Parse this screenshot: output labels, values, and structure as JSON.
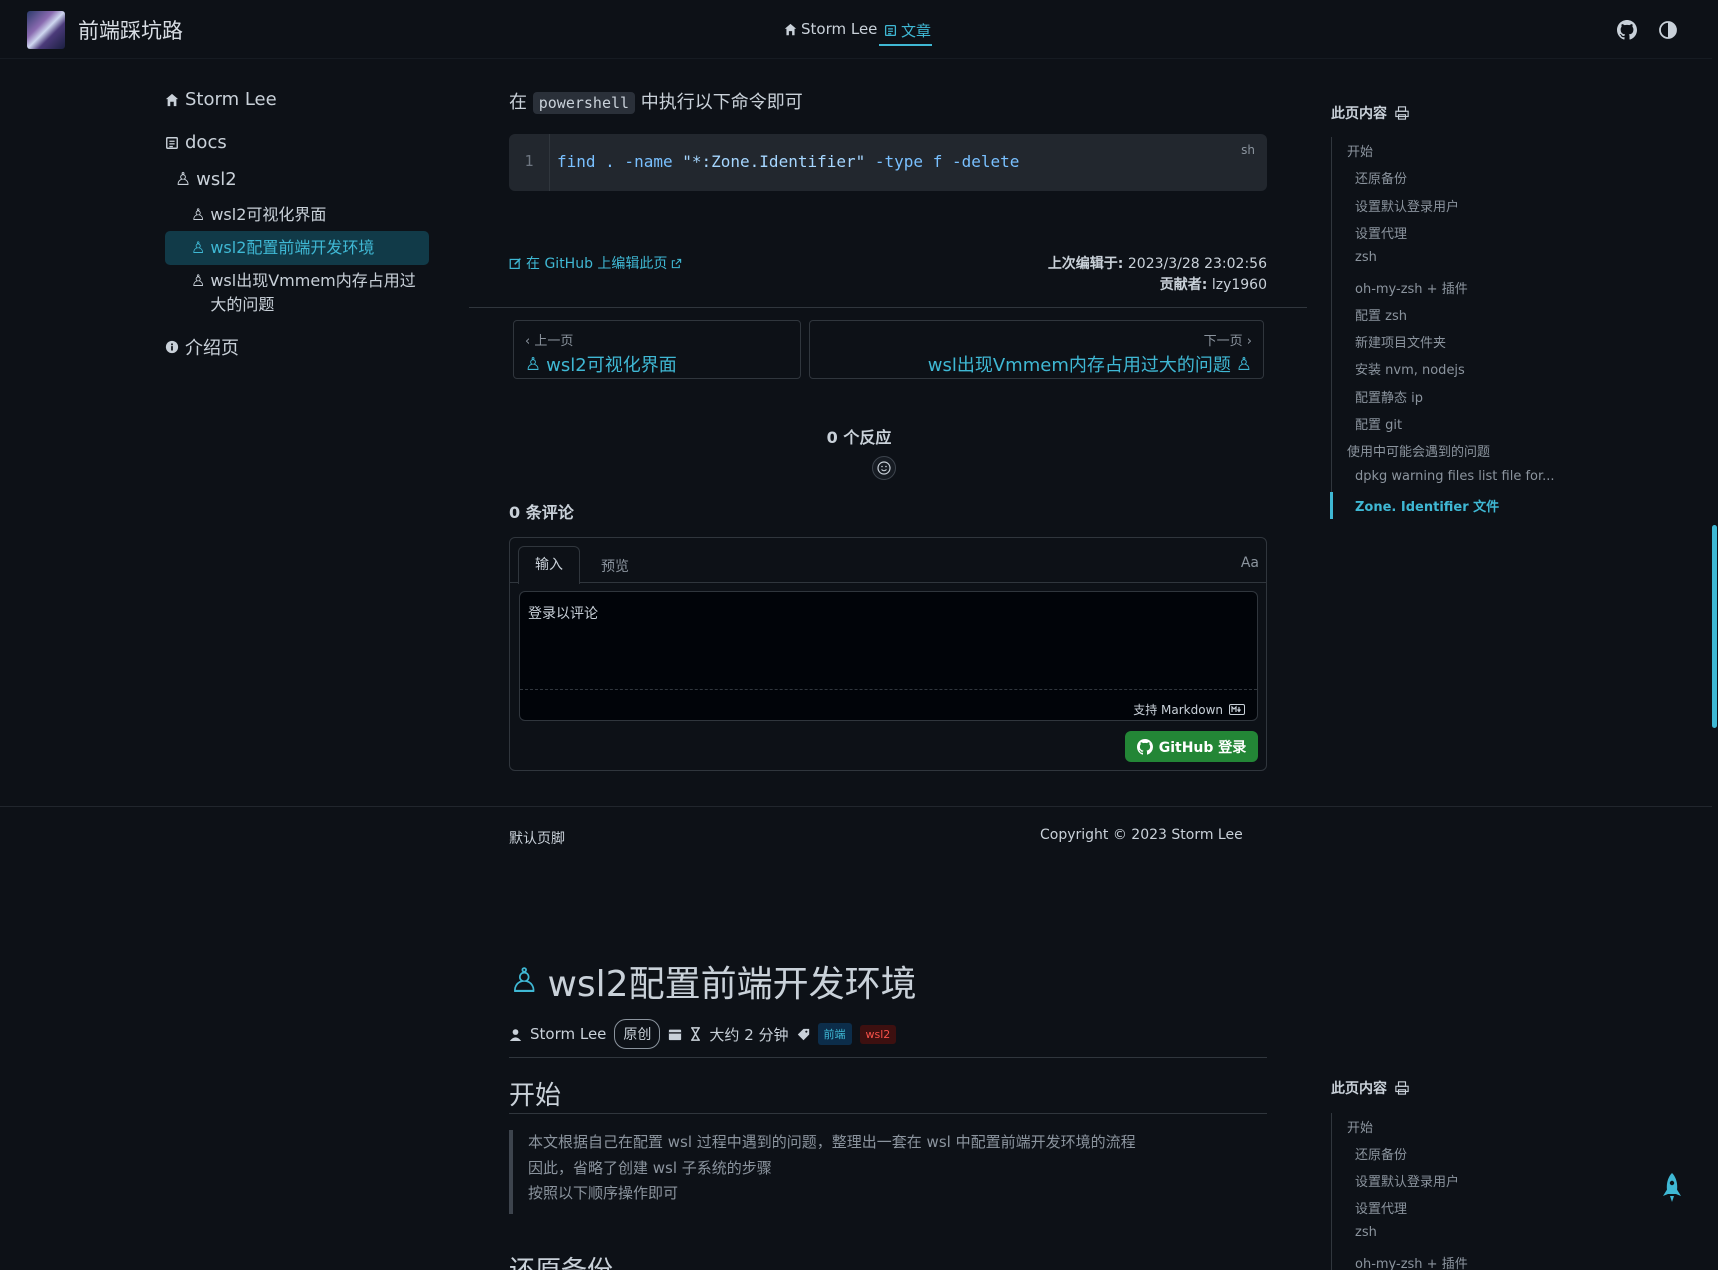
{
  "navbar": {
    "site_name": "前端踩坑路",
    "links": [
      {
        "label": "Storm Lee",
        "icon": "home-icon"
      },
      {
        "label": "文章",
        "icon": "article-icon",
        "active": true
      }
    ],
    "right_icons": [
      "github-icon",
      "theme-toggle-icon"
    ]
  },
  "sidebar": {
    "home": "Storm Lee",
    "docs": "docs",
    "wsl2": "wsl2",
    "items": [
      {
        "label": "wsl2可视化界面"
      },
      {
        "label": "wsl2配置前端开发环境",
        "active": true
      },
      {
        "label": "wsl出现Vmmem内存占用过大的问题"
      }
    ],
    "intro": "介绍页"
  },
  "article_top": {
    "paragraph_pre": "在",
    "inline_code": "powershell",
    "paragraph_post": "中执行以下命令即可",
    "code": {
      "line_number": "1",
      "cmd": "find . -name ",
      "str": "\"*:Zone.Identifier\"",
      "rest": " -type f -delete",
      "lang": "sh"
    },
    "edit_link": "在 GitHub 上编辑此页",
    "last_edited_label": "上次编辑于:",
    "last_edited_value": "2023/3/28 23:02:56",
    "contributors_label": "贡献者:",
    "contributors_value": "lzy1960"
  },
  "pager": {
    "prev_hint": "‹ 上一页",
    "prev_title": "wsl2可视化界面",
    "next_hint": "下一页 ›",
    "next_title": "wsl出现Vmmem内存占用过大的问题"
  },
  "comments": {
    "reactions": "0 个反应",
    "count": "0 条评论",
    "tab_input": "输入",
    "tab_preview": "预览",
    "font_toggle": "Aa",
    "placeholder": "登录以评论",
    "markdown_note": "支持 Markdown",
    "login_button": "GitHub 登录"
  },
  "footer": {
    "left": "默认页脚",
    "right": "Copyright © 2023 Storm Lee"
  },
  "article": {
    "title": "wsl2配置前端开发环境",
    "author": "Storm Lee",
    "original_badge": "原创",
    "read_time": "大约 2 分钟",
    "tags": [
      "前端",
      "wsl2"
    ],
    "h2_start": "开始",
    "quote_lines": [
      "本文根据自己在配置 wsl 过程中遇到的问题，整理出一套在 wsl 中配置前端开发环境的流程",
      "因此，省略了创建 wsl 子系统的步骤",
      "按照以下顺序操作即可"
    ],
    "h2_next": "还原备份"
  },
  "toc": {
    "title": "此页内容",
    "items": [
      {
        "label": "开始",
        "level": 1
      },
      {
        "label": "还原备份",
        "level": 2
      },
      {
        "label": "设置默认登录用户",
        "level": 2
      },
      {
        "label": "设置代理",
        "level": 2
      },
      {
        "label": "zsh",
        "level": 2
      },
      {
        "label": "oh-my-zsh + 插件",
        "level": 2
      },
      {
        "label": "配置 zsh",
        "level": 2
      },
      {
        "label": "新建项目文件夹",
        "level": 2
      },
      {
        "label": "安装 nvm, nodejs",
        "level": 2
      },
      {
        "label": "配置静态 ip",
        "level": 2
      },
      {
        "label": "配置 git",
        "level": 2
      },
      {
        "label": "使用中可能会遇到的问题",
        "level": 1
      },
      {
        "label": "dpkg warning files list file for...",
        "level": 2
      },
      {
        "label": "Zone. Identifier 文件",
        "level": 2,
        "active": true
      }
    ],
    "items_bottom": [
      {
        "label": "开始",
        "level": 1
      },
      {
        "label": "还原备份",
        "level": 2
      },
      {
        "label": "设置默认登录用户",
        "level": 2
      },
      {
        "label": "设置代理",
        "level": 2
      },
      {
        "label": "zsh",
        "level": 2
      },
      {
        "label": "oh-my-zsh + 插件",
        "level": 2
      }
    ]
  },
  "colors": {
    "background": "#0d1117",
    "accent": "#3fb8d4",
    "button_green": "#238636"
  }
}
